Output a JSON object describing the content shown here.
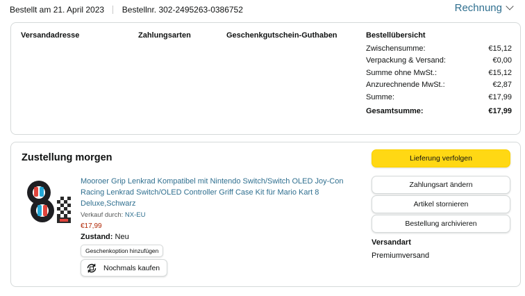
{
  "header": {
    "ordered": "Bestellt am 21. April 2023",
    "order_number": "Bestellnr. 302-2495263-0386752",
    "invoice_label": "Rechnung"
  },
  "details": {
    "shipping_address_label": "Versandadresse",
    "payment_methods_label": "Zahlungsarten",
    "gift_card_label": "Geschenkgutschein-Guthaben"
  },
  "summary": {
    "title": "Bestellübersicht",
    "rows": [
      {
        "label": "Zwischensumme:",
        "value": "€15,12"
      },
      {
        "label": "Verpackung & Versand:",
        "value": "€0,00"
      },
      {
        "label": "Summe ohne MwSt.:",
        "value": "€15,12"
      },
      {
        "label": "Anzurechnende MwSt.:",
        "value": "€2,87"
      },
      {
        "label": "Summe:",
        "value": "€17,99"
      },
      {
        "label": "Gesamtsumme:",
        "value": "€17,99"
      }
    ]
  },
  "delivery": {
    "title": "Zustellung morgen",
    "product_title": "Mooroer Grip Lenkrad Kompatibel mit Nintendo Switch/Switch OLED Joy-Con Racing Lenkrad Switch/OLED Controller Griff Case Kit für Mario Kart 8 Deluxe,Schwarz",
    "seller_prefix": "Verkauf durch:",
    "seller_name": "NX-EU",
    "price": "€17,99",
    "condition_label": "Zustand:",
    "condition_value": "Neu",
    "gift_option": "Geschenkoption hinzufügen",
    "buy_again": "Nochmals kaufen"
  },
  "actions": {
    "track": "Lieferung verfolgen",
    "change_payment": "Zahlungsart ändern",
    "cancel": "Artikel stornieren",
    "archive": "Bestellung archivieren"
  },
  "shipping": {
    "label": "Versandart",
    "value": "Premiumversand"
  },
  "colors": {
    "link": "#2f6f8f",
    "price": "#b12704",
    "primary_button": "#ffd814",
    "border": "#d5d9d9"
  }
}
